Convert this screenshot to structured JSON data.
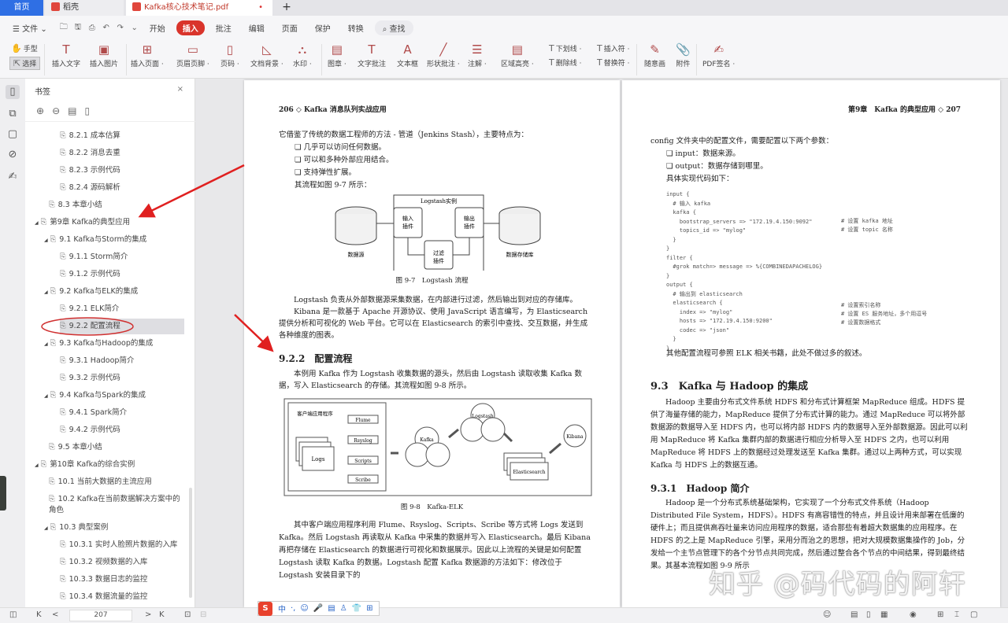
{
  "tabs": {
    "home": "首页",
    "daoke": "稻壳",
    "doc": "Kafka核心技术笔记.pdf",
    "new": "+"
  },
  "menu": {
    "file": "文件",
    "items": [
      "开始",
      "插入",
      "批注",
      "编辑",
      "页面",
      "保护",
      "转换"
    ],
    "active": "插入",
    "search": "查找"
  },
  "tools": {
    "hand": "手型",
    "select": "选择",
    "big": [
      {
        "label": "插入文字",
        "icon": "T"
      },
      {
        "label": "插入图片",
        "icon": "▣"
      },
      {
        "label": "插入页面 ·",
        "icon": "⊞"
      },
      {
        "label": "页眉页脚 ·",
        "icon": "▭"
      },
      {
        "label": "页码 ·",
        "icon": "▯"
      },
      {
        "label": "文档背景 ·",
        "icon": "◺"
      },
      {
        "label": "水印 ·",
        "icon": "⛬"
      },
      {
        "label": "图章 ·",
        "icon": "▤"
      },
      {
        "label": "文字批注",
        "icon": "T"
      },
      {
        "label": "文本框",
        "icon": "A"
      },
      {
        "label": "形状批注 ·",
        "icon": "╱"
      },
      {
        "label": "注解 ·",
        "icon": "☰"
      },
      {
        "label": "区域高亮 ·",
        "icon": "▤"
      }
    ],
    "small": [
      {
        "label": "下划线 ·",
        "icon": "T"
      },
      {
        "label": "删除线 ·",
        "icon": "T"
      },
      {
        "label": "插入符 ·",
        "icon": "T"
      },
      {
        "label": "替换符 ·",
        "icon": "T"
      }
    ],
    "draw": "随意画",
    "attach": "附件",
    "sign": "PDF签名 ·"
  },
  "sidebar": {
    "title": "书签",
    "close": "×",
    "items": [
      {
        "label": "8.2.1 成本估算",
        "level": 3
      },
      {
        "label": "8.2.2 消息去重",
        "level": 3
      },
      {
        "label": "8.2.3 示例代码",
        "level": 3
      },
      {
        "label": "8.2.4 源码解析",
        "level": 3
      },
      {
        "label": "8.3 本章小结",
        "level": 2
      },
      {
        "label": "第9章 Kafka的典型应用",
        "level": 1,
        "expanded": true
      },
      {
        "label": "9.1 Kafka与Storm的集成",
        "level": 2,
        "expanded": true
      },
      {
        "label": "9.1.1 Storm简介",
        "level": 3
      },
      {
        "label": "9.1.2 示例代码",
        "level": 3
      },
      {
        "label": "9.2 Kafka与ELK的集成",
        "level": 2,
        "expanded": true
      },
      {
        "label": "9.2.1 ELK简介",
        "level": 3
      },
      {
        "label": "9.2.2 配置流程",
        "level": 3,
        "selected": true
      },
      {
        "label": "9.3 Kafka与Hadoop的集成",
        "level": 2,
        "expanded": true
      },
      {
        "label": "9.3.1 Hadoop简介",
        "level": 3
      },
      {
        "label": "9.3.2 示例代码",
        "level": 3
      },
      {
        "label": "9.4 Kafka与Spark的集成",
        "level": 2,
        "expanded": true
      },
      {
        "label": "9.4.1 Spark简介",
        "level": 3
      },
      {
        "label": "9.4.2 示例代码",
        "level": 3
      },
      {
        "label": "9.5 本章小结",
        "level": 2
      },
      {
        "label": "第10章 Kafka的综合实例",
        "level": 1,
        "expanded": true
      },
      {
        "label": "10.1 当前大数据的主流应用",
        "level": 2
      },
      {
        "label": "10.2 Kafka在当前数据解决方案中的\n角色",
        "level": 2
      },
      {
        "label": "10.3 典型案例",
        "level": 2,
        "expanded": true
      },
      {
        "label": "10.3.1 实时人脸照片数据的入库",
        "level": 3
      },
      {
        "label": "10.3.2 视频数据的入库",
        "level": 3
      },
      {
        "label": "10.3.3 数据日志的监控",
        "level": 3
      },
      {
        "label": "10.3.4 数据流量的监控",
        "level": 3
      }
    ]
  },
  "page_left": {
    "header": "206 ◇ Kafka 消息队列实战应用",
    "intro": "它借鉴了传统的数据工程师的方法 - 管道（Jenkins Stash），主要特点为：",
    "bullets": [
      "几乎可以访问任何数据。",
      "可以和多种外部应用结合。",
      "支持弹性扩展。"
    ],
    "intro2": "其流程如图 9-7 所示：",
    "fig1": {
      "title": "Logstash实例",
      "input": "输入\n插件",
      "filter": "过滤\n插件",
      "output": "输出\n插件",
      "source": "数据源",
      "dest": "数据存储库",
      "caption": "图 9-7　Logstash 流程"
    },
    "p1": "Logstash 负责从外部数据源采集数据，在内部进行过滤，然后输出到对应的存储库。",
    "p2": "Kibana 是一款基于 Apache 开源协议、使用 JavaScript 语言编写，为 Elasticsearch 提供分析和可视化的 Web 平台。它可以在 Elasticsearch 的索引中查找、交互数据，并生成各种维度的图表。",
    "section": "9.2.2　配置流程",
    "p3": "本例用 Kafka 作为 Logstash 收集数据的源头，然后由 Logstash 读取收集 Kafka 数据，写入 Elasticsearch 的存储。其流程如图 9-8 所示。",
    "fig2": {
      "client": "客户端应用程序",
      "agents": [
        "Flume",
        "Rsyslog",
        "Scripts",
        "Scribe"
      ],
      "logs": "Logs",
      "kafka": "Kafka",
      "logstash": "Logstash",
      "es": "Elasticsearch",
      "kibana": "Kibana",
      "caption": "图 9-8　Kafka-ELK"
    },
    "p4": "其中客户端应用程序利用 Flume、Rsyslog、Scripts、Scribe 等方式将 Logs 发送到 Kafka。然后 Logstash 再读取从 Kafka 中采集的数据并写入 Elasticsearch。最后 Kibana 再把存储在 Elasticsearch 的数据进行可视化和数据展示。因此以上流程的关键是如何配置 Logstash 读取 Kafka 的数据。Logstash 配置 Kafka 数据源的方法如下：修改位于 Logstash 安装目录下的"
  },
  "page_right": {
    "header": "第9章　Kafka 的典型应用 ◇ 207",
    "intro": "config 文件夹中的配置文件，需要配置以下两个参数：",
    "bullets": [
      "input：数据来源。",
      "output：数据存储到哪里。"
    ],
    "intro2": "具体实现代码如下：",
    "code": "input {\n  # 输入 kafka\n  kafka {\n    bootstrap_servers => \"172.19.4.150:9092\"\n    topics_id => \"mylog\"\n  }\n}\nfilter {\n  #grok match=> message => %{COMBINEDAPACHELOG}\n}\noutput {\n  # 输出到 elasticsearch\n  elasticsearch {\n    index => \"mylog\"\n    hosts => \"172.19.4.150:9200\"\n    codec => \"json\"\n  }\n}",
    "comments": [
      "# 设置 kafka 地址",
      "# 设置 topic 名称",
      "# 设置索引名称",
      "# 设置 ES 服务地址，多个用逗号",
      "# 设置数据格式"
    ],
    "p1": "其他配置流程可参照 ELK 相关书籍，此处不做过多的叙述。",
    "section": "9.3　Kafka 与 Hadoop 的集成",
    "p2": "Hadoop 主要由分布式文件系统 HDFS 和分布式计算框架 MapReduce 组成。HDFS 提供了海量存储的能力，MapReduce 提供了分布式计算的能力。通过 MapReduce 可以将外部数据源的数据导入至 HDFS 内，也可以将内部 HDFS 内的数据导入至外部数据源。因此可以利用 MapReduce 将 Kafka 集群内部的数据进行相应分析导入至 HDFS 之内，也可以利用 MapReduce 将 HDFS 上的数据经过处理发送至 Kafka 集群。通过以上两种方式，可以实现 Kafka 与 HDFS 上的数据互通。",
    "subsection": "9.3.1　Hadoop 简介",
    "p3": "Hadoop 是一个分布式系统基础架构，它实现了一个分布式文件系统（Hadoop Distributed File System，HDFS）。HDFS 有高容错性的特点，并且设计用来部署在低廉的硬件上；而且提供高吞吐量来访问应用程序的数据，适合那些有着超大数据集的应用程序。在 HDFS 的之上是 MapReduce 引擎，采用分而治之的思想，把对大规模数据集操作的 Job，分发给一个主节点管理下的各个分节点共同完成，然后通过整合各个节点的中间结果，得到最终结果。其基本流程如图 9-9 所示"
  },
  "status": {
    "first": "K",
    "prev": "<",
    "page": "207",
    "next": ">",
    "last": "K",
    "ime": [
      "中",
      "·,",
      "☺",
      "🎤",
      "▤",
      "♙",
      "👕",
      "⊞"
    ]
  },
  "watermark": "知乎 @码代码的阿轩",
  "colors": {
    "accent": "#d9342b",
    "home_tab": "#2f6fe4",
    "annotation": "#e02020"
  }
}
